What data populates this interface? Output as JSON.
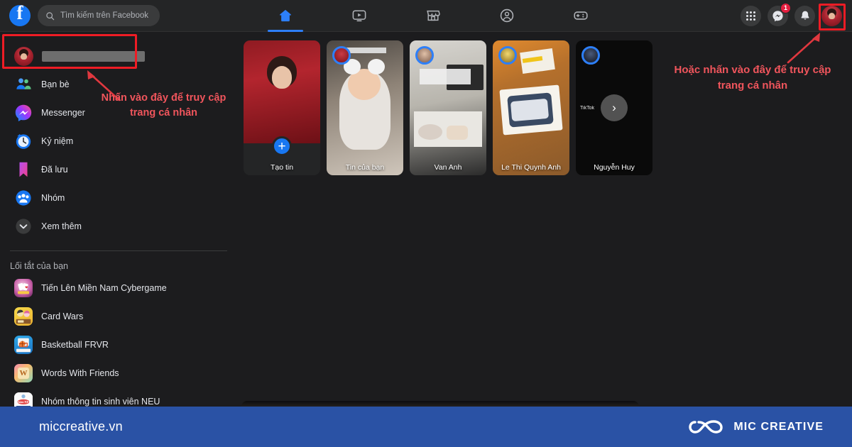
{
  "topbar": {
    "logo": "facebook-logo",
    "search": {
      "placeholder": "Tìm kiếm trên Facebook",
      "value": "",
      "icon": "search-icon"
    },
    "tabs": [
      {
        "name": "home",
        "icon": "home-icon",
        "active": true
      },
      {
        "name": "watch",
        "icon": "video-icon",
        "active": false
      },
      {
        "name": "marketplace",
        "icon": "store-icon",
        "active": false
      },
      {
        "name": "groups",
        "icon": "groups-icon",
        "active": false
      },
      {
        "name": "gaming",
        "icon": "gaming-icon",
        "active": false
      }
    ],
    "actions": [
      {
        "name": "menu-grid",
        "icon": "grid-icon",
        "badge": ""
      },
      {
        "name": "messenger",
        "icon": "messenger-icon",
        "badge": "1"
      },
      {
        "name": "notifications",
        "icon": "bell-icon",
        "badge": ""
      }
    ],
    "account_avatar": "profile-avatar"
  },
  "sidebar": {
    "profile": {
      "name": "",
      "redacted": true,
      "avatar": "profile-avatar"
    },
    "items": [
      {
        "label": "Bạn bè",
        "icon": "friends-icon"
      },
      {
        "label": "Messenger",
        "icon": "messenger-icon"
      },
      {
        "label": "Kỷ niệm",
        "icon": "memories-clock-icon"
      },
      {
        "label": "Đã lưu",
        "icon": "bookmark-icon"
      },
      {
        "label": "Nhóm",
        "icon": "groups-icon"
      },
      {
        "label": "Xem thêm",
        "icon": "chevron-down-icon"
      }
    ],
    "shortcuts_title": "Lối tắt của bạn",
    "shortcuts": [
      {
        "label": "Tiến Lên Miền Nam Cybergame",
        "icon": "card-game-icon"
      },
      {
        "label": "Card Wars",
        "icon": "card-wars-icon"
      },
      {
        "label": "Basketball FRVR",
        "icon": "basketball-icon"
      },
      {
        "label": "Words With Friends",
        "icon": "words-with-friends-icon"
      },
      {
        "label": "Nhóm thông tin sinh viên NEU",
        "icon": "neu-group-icon"
      }
    ]
  },
  "stories": [
    {
      "label": "Tạo tin",
      "type": "create",
      "button": "+"
    },
    {
      "label": "Tin của bạn",
      "type": "story"
    },
    {
      "label": "Van Anh",
      "type": "story"
    },
    {
      "label": "Le Thi Quynh Anh",
      "type": "story"
    },
    {
      "label": "Nguyễn Huy",
      "type": "story",
      "next_arrow": "›",
      "tag": "TikTok"
    }
  ],
  "annotations": [
    {
      "name": "sidebar-profile-callout",
      "text": "Nhấn vào đây để truy cập trang cá nhân",
      "color": "#f0555c"
    },
    {
      "name": "topbar-avatar-callout",
      "text": "Hoặc nhấn vào đây để truy cập trang cá nhân",
      "color": "#f0555c"
    }
  ],
  "highlights": {
    "color": "#ee1c25"
  },
  "banner": {
    "site": "miccreative.vn",
    "brand_name": "MIC CREATIVE",
    "logo": "infinity-knot-logo",
    "background": "#2a52a5"
  }
}
